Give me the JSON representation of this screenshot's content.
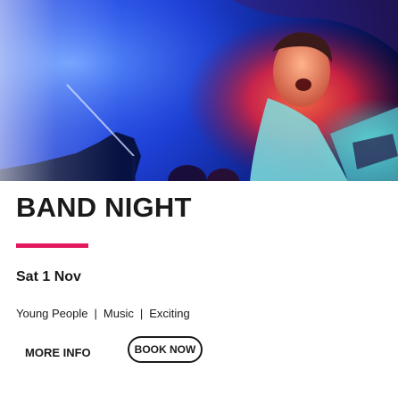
{
  "event": {
    "title": "BAND NIGHT",
    "date": "Sat 1 Nov",
    "tags": [
      "Young People",
      "Music",
      "Exciting"
    ],
    "tag_separator": "|"
  },
  "actions": {
    "more_info_label": "MORE INFO",
    "book_now_label": "BOOK NOW"
  },
  "hero_image": {
    "alt": "Band performing on stage",
    "colors": {
      "stage_blue": "#1d3fd4",
      "stage_red": "#e8233a",
      "warm_light": "#ff9a4a"
    }
  },
  "colors": {
    "accent": "#e2195f",
    "text": "#1a1a1a",
    "background": "#ffffff"
  }
}
